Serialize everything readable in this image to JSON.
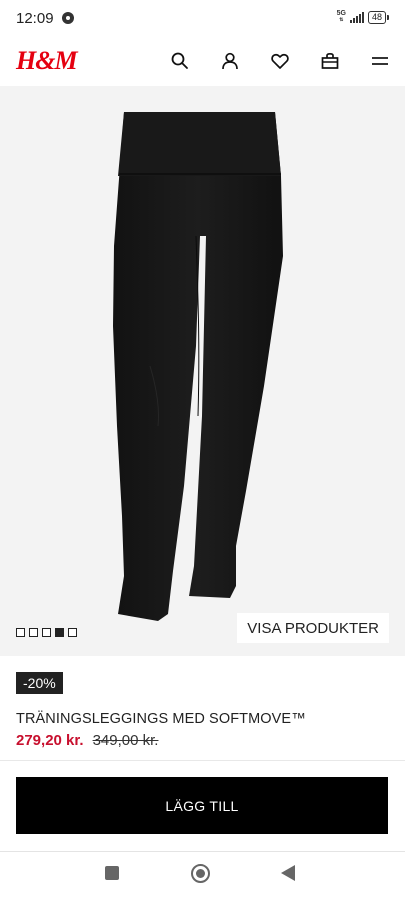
{
  "status_bar": {
    "time": "12:09",
    "network": "5G",
    "battery": "48"
  },
  "header": {
    "logo": "H&M",
    "brand_color": "#e50010",
    "icons": [
      "search-icon",
      "account-icon",
      "favorites-icon",
      "bag-icon",
      "menu-icon"
    ]
  },
  "gallery": {
    "total_images": 5,
    "active_index": 4,
    "visa_label": "VISA PRODUKTER"
  },
  "product": {
    "discount": "-20%",
    "title": "TRÄNINGSLEGGINGS MED SOFTMOVE™",
    "sale_price": "279,20 kr.",
    "original_price": "349,00 kr.",
    "sale_color": "#c8102e"
  },
  "actions": {
    "add_label": "LÄGG TILL"
  },
  "system_nav": [
    "recents-button",
    "home-button",
    "back-button"
  ]
}
